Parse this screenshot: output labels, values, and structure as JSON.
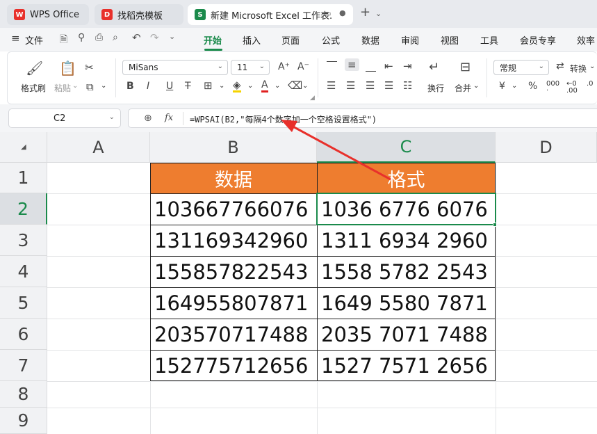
{
  "tabs": [
    {
      "label": "WPS Office"
    },
    {
      "label": "找稻壳模板"
    },
    {
      "label": "新建 Microsoft Excel 工作表."
    }
  ],
  "menu": {
    "file_label": "文件",
    "items": [
      "开始",
      "插入",
      "页面",
      "公式",
      "数据",
      "审阅",
      "视图",
      "工具",
      "会员专享",
      "效率"
    ],
    "active": "开始"
  },
  "ribbon": {
    "format_painter": "格式刷",
    "paste": "粘贴",
    "font_name": "MiSans",
    "font_size": "11",
    "wrap": "换行",
    "merge": "合并",
    "number_format": "常规",
    "convert": "转换",
    "bold": "B",
    "italic": "I",
    "underline": "U",
    "percent": "%",
    "currency": "¥"
  },
  "formula_bar": {
    "name_box": "C2",
    "fx": "fx",
    "formula": "=WPSAI(B2,\"每隔4个数字加一个空格设置格式\")"
  },
  "sheet": {
    "columns": [
      "A",
      "B",
      "C",
      "D"
    ],
    "rows": [
      "1",
      "2",
      "3",
      "4",
      "5",
      "6",
      "7",
      "8",
      "9"
    ],
    "header_data": "数据",
    "header_format": "格式",
    "data": [
      {
        "raw": "103667766076",
        "formatted": "1036 6776 6076"
      },
      {
        "raw": "131169342960",
        "formatted": "1311 6934 2960"
      },
      {
        "raw": "155857822543",
        "formatted": "1558 5782 2543"
      },
      {
        "raw": "164955807871",
        "formatted": "1649 5580 7871"
      },
      {
        "raw": "203570717488",
        "formatted": "2035 7071 7488"
      },
      {
        "raw": "152775712656",
        "formatted": "1527 7571 2656"
      }
    ],
    "active_cell": "C2"
  },
  "colors": {
    "accent": "#1a8a4b",
    "header_fill": "#ee7d2f",
    "annotation_arrow": "#e8302b"
  }
}
